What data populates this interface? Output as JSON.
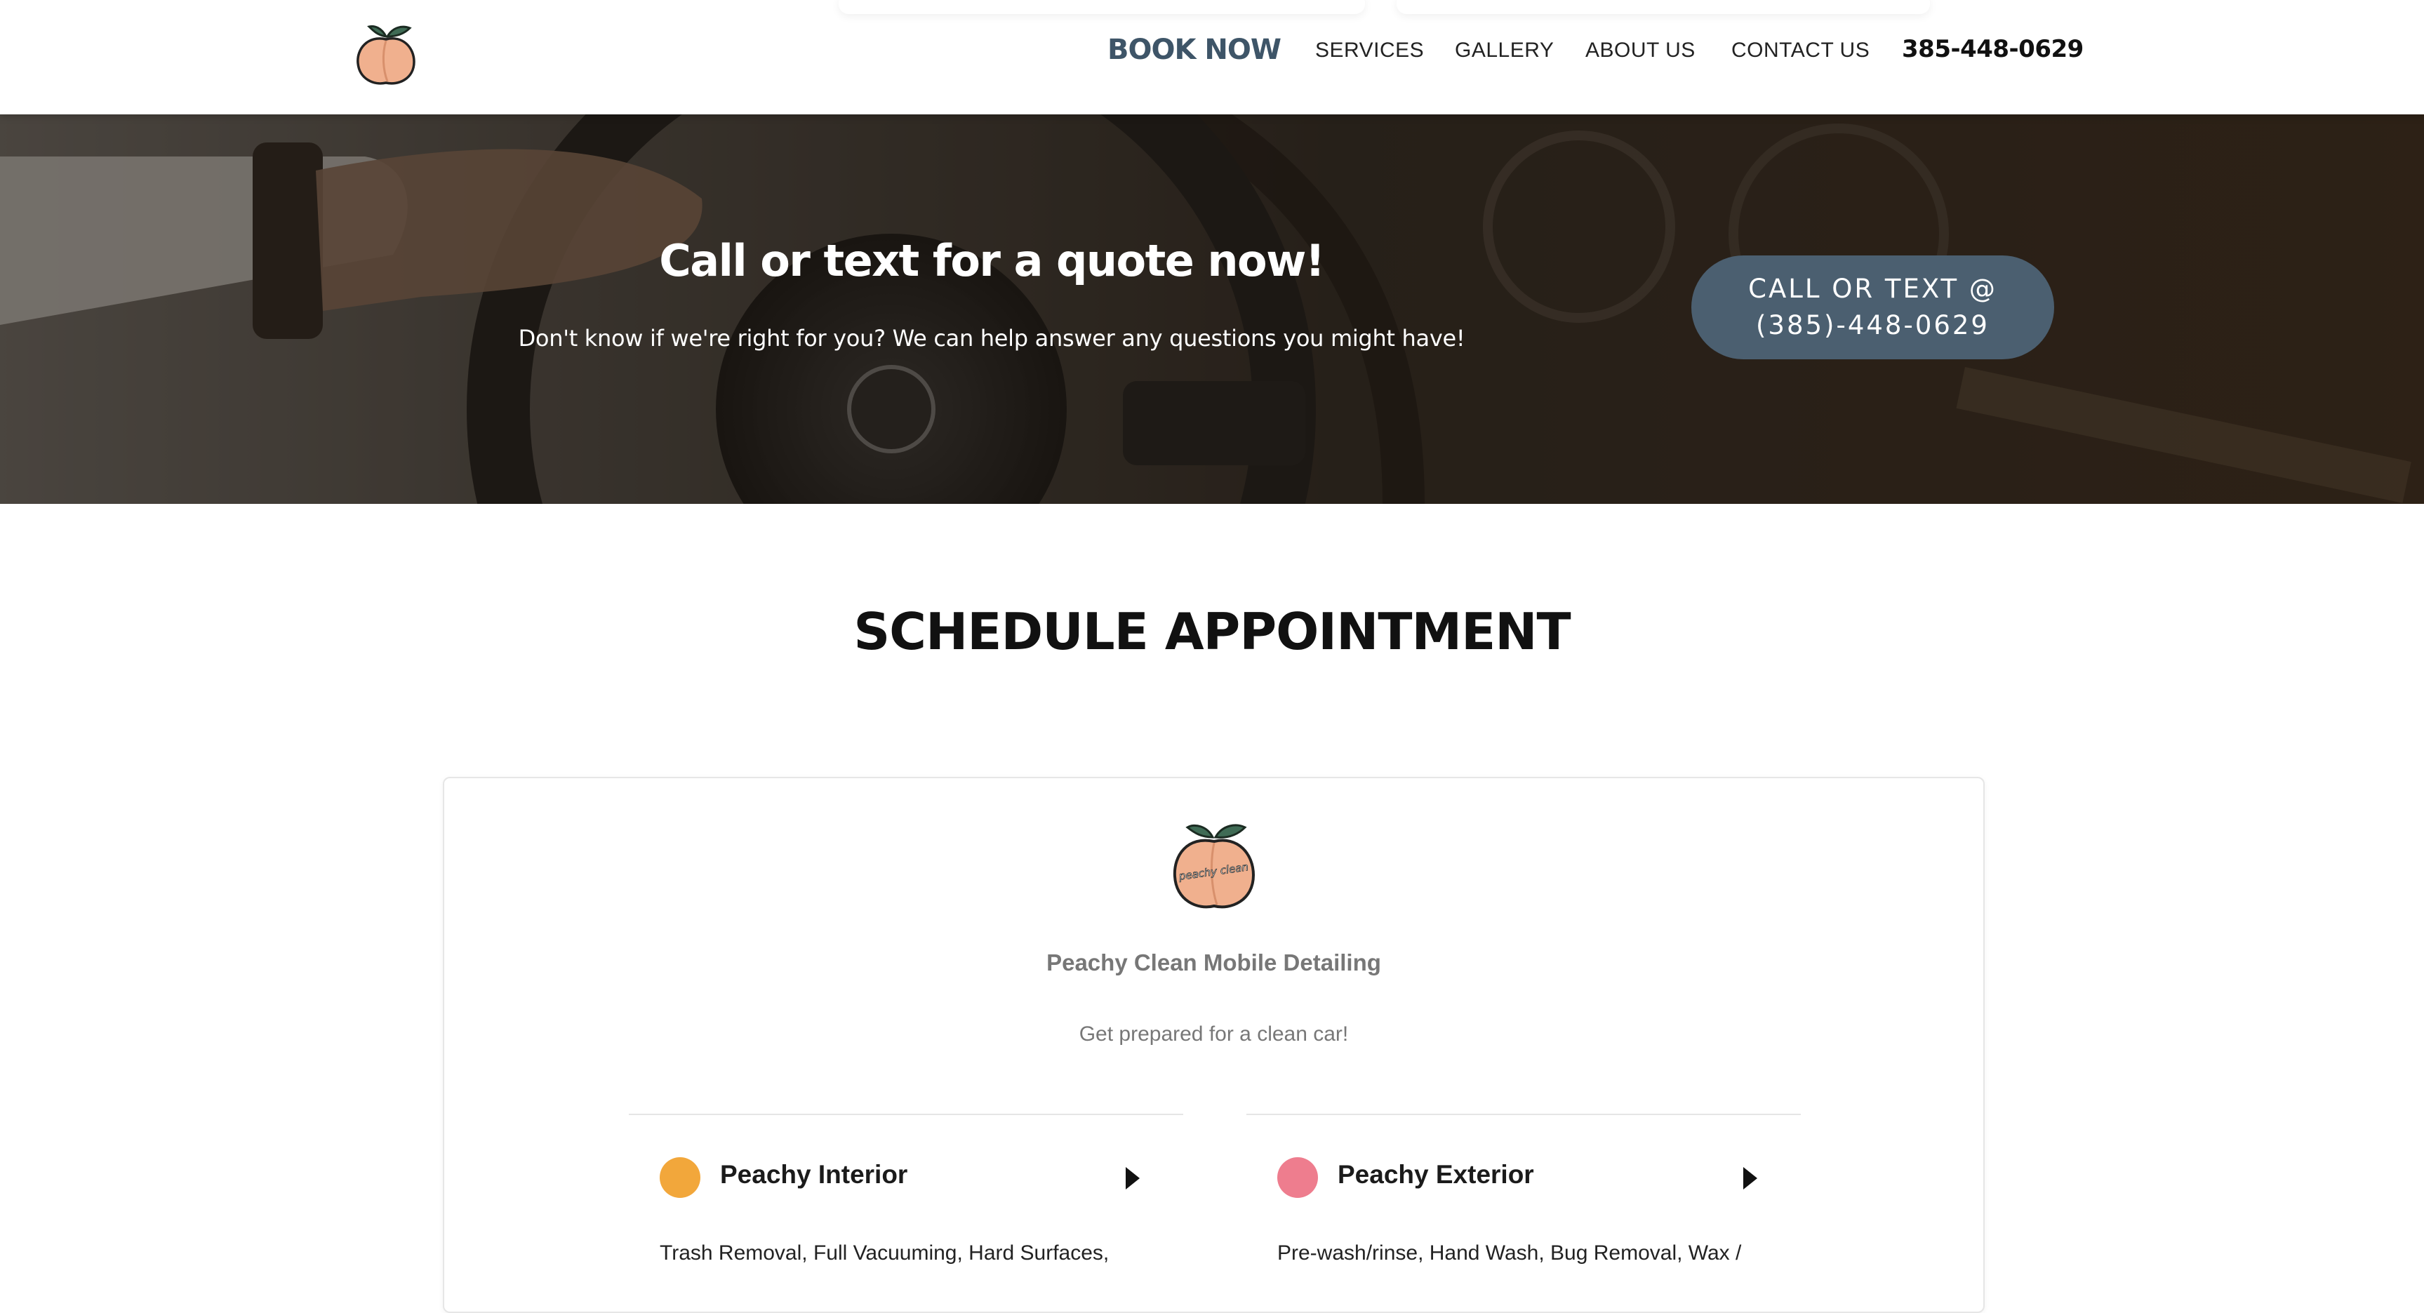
{
  "nav": {
    "book_now": "BOOK NOW",
    "links": [
      "SERVICES",
      "GALLERY",
      "ABOUT US",
      "CONTACT US"
    ],
    "phone": "385-448-0629"
  },
  "hero": {
    "title": "Call or text for a quote now!",
    "subtitle": "Don't know if we're right for you? We can help answer any questions you might have!",
    "button_line1": "CALL OR TEXT @",
    "button_line2": "(385)-448-0629"
  },
  "schedule": {
    "title": "SCHEDULE APPOINTMENT",
    "business_name": "Peachy Clean Mobile Detailing",
    "tagline": "Get prepared for a clean car!",
    "logo_text": "peachy clean",
    "services": [
      {
        "name": "Peachy Interior",
        "color": "#f2a73b",
        "description": "Trash Removal, Full Vacuuming, Hard Surfaces,"
      },
      {
        "name": "Peachy Exterior",
        "color": "#ee7d8e",
        "description": "Pre-wash/rinse, Hand Wash, Bug Removal, Wax /"
      }
    ]
  },
  "colors": {
    "accent": "#3e5568",
    "button": "#4b5f70",
    "peach": "#f0b08e"
  }
}
